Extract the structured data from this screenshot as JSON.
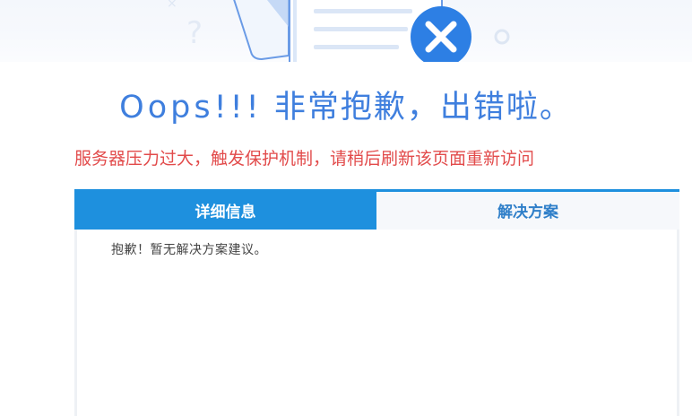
{
  "colors": {
    "title": "#3f7fde",
    "subtitle": "#e24b4b",
    "tab_active_bg": "#1e90de",
    "tab_inactive_text": "#2f7fc9",
    "error_badge": "#2d7fe4"
  },
  "icons": {
    "illustration": "error-document-illustration",
    "error_badge": "close-icon"
  },
  "title": {
    "latin": "Oops!!!",
    "cjk": "非常抱歉，出错啦。"
  },
  "subtitle": "服务器压力过大，触发保护机制，请稍后刷新该页面重新访问",
  "tabs": [
    {
      "label": "详细信息",
      "active": true
    },
    {
      "label": "解决方案",
      "active": false
    }
  ],
  "tab_content": "抱歉！暂无解决方案建议。"
}
